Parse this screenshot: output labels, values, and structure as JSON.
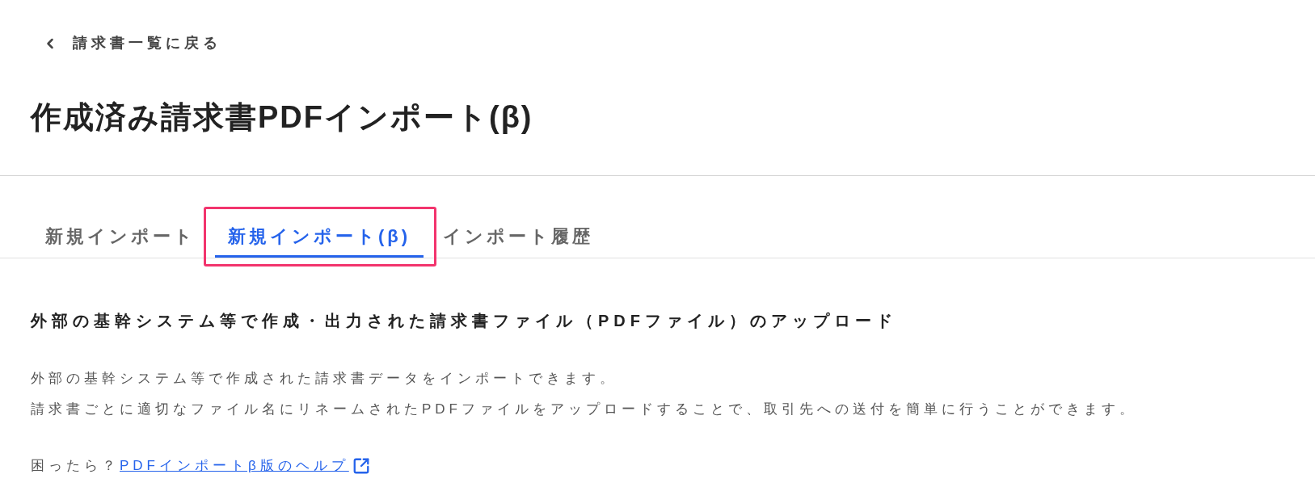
{
  "back_link": {
    "label": "請求書一覧に戻る"
  },
  "title": "作成済み請求書PDFインポート(β)",
  "tabs": [
    {
      "label": "新規インポート",
      "selected": false,
      "highlighted": false
    },
    {
      "label": "新規インポート(β)",
      "selected": true,
      "highlighted": true
    },
    {
      "label": "インポート履歴",
      "selected": false,
      "highlighted": false
    }
  ],
  "section": {
    "heading": "外部の基幹システム等で作成・出力された請求書ファイル（PDFファイル）のアップロード",
    "description": [
      "外部の基幹システム等で作成された請求書データをインポートできます。",
      "請求書ごとに適切なファイル名にリネームされたPDFファイルをアップロードすることで、取引先への送付を簡単に行うことができます。"
    ],
    "help": {
      "prefix": "困ったら？",
      "link": "PDFインポートβ版のヘルプ"
    }
  }
}
